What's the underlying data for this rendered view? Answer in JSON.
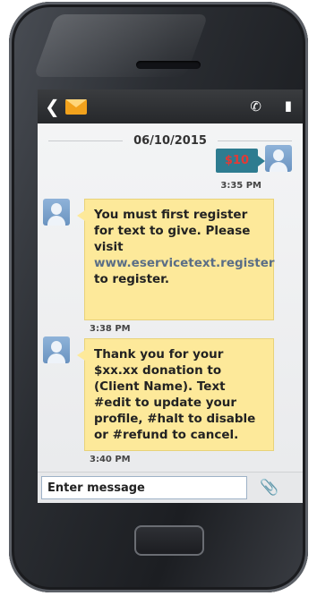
{
  "header": {
    "back_icon": "chevron-left-icon",
    "mail_icon": "envelope-icon",
    "call_icon": "phone-icon",
    "delete_icon": "trash-icon"
  },
  "conversation": {
    "date": "06/10/2015",
    "messages": [
      {
        "direction": "sent",
        "text": "$10",
        "time": "3:35 PM"
      },
      {
        "direction": "received",
        "text_before": "You must first register for text to give. Please visit",
        "link": "www.eservicetext.register",
        "text_after": "to register.",
        "time": "3:38 PM"
      },
      {
        "direction": "received",
        "text": "Thank you for your $xx.xx donation to (Client Name). Text #edit to update your profile, #halt to disable or #refund to cancel.",
        "time": "3:40 PM"
      }
    ]
  },
  "composer": {
    "placeholder": "Enter message",
    "attach_icon": "paperclip-icon"
  },
  "colors": {
    "sent_bubble": "#2e7c90",
    "sent_text": "#e53935",
    "received_bubble": "#fde99a"
  }
}
